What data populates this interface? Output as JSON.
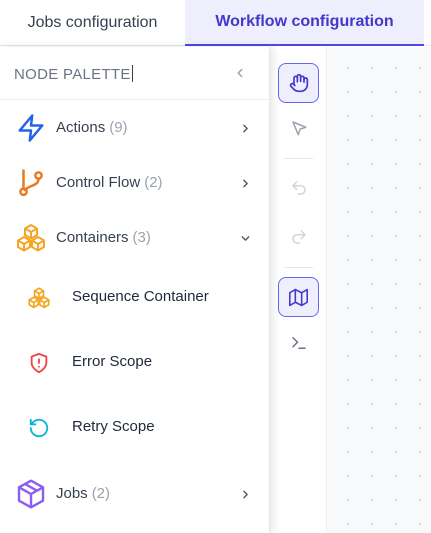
{
  "tabs": [
    {
      "label": "Jobs configuration",
      "active": false
    },
    {
      "label": "Workflow configuration",
      "active": true
    }
  ],
  "palette": {
    "title": "NODE PALETTE",
    "collapse_icon": "chevron-left-icon",
    "categories": [
      {
        "label": "Actions",
        "count": "(9)",
        "icon": "lightning-bolt-icon",
        "color": "#2563eb",
        "expanded": false
      },
      {
        "label": "Control Flow",
        "count": "(2)",
        "icon": "git-branch-icon",
        "color": "#ea7a1f",
        "expanded": false
      },
      {
        "label": "Containers",
        "count": "(3)",
        "icon": "boxes-icon",
        "color": "#f5a524",
        "expanded": true
      },
      {
        "label": "Jobs",
        "count": "(2)",
        "icon": "cube-icon",
        "color": "#8b5cf6",
        "expanded": false
      }
    ],
    "container_items": [
      {
        "label": "Sequence Container",
        "icon": "boxes-icon",
        "color": "#f5a524"
      },
      {
        "label": "Error Scope",
        "icon": "shield-alert-icon",
        "color": "#ef4444"
      },
      {
        "label": "Retry Scope",
        "icon": "rotate-ccw-icon",
        "color": "#06b6d4"
      }
    ]
  },
  "toolbar": [
    {
      "name": "pan-hand-tool",
      "icon": "hand-icon",
      "active": true
    },
    {
      "name": "select-pointer-tool",
      "icon": "pointer-icon",
      "active": false
    },
    {
      "name": "undo-button",
      "icon": "undo-icon",
      "active": false
    },
    {
      "name": "redo-button",
      "icon": "redo-icon",
      "active": false
    },
    {
      "name": "minimap-toggle",
      "icon": "map-icon",
      "active": true
    },
    {
      "name": "console-button",
      "icon": "terminal-icon",
      "active": false
    }
  ],
  "colors": {
    "accent": "#4f46e5",
    "active_tab_bg": "#eeeefc"
  }
}
